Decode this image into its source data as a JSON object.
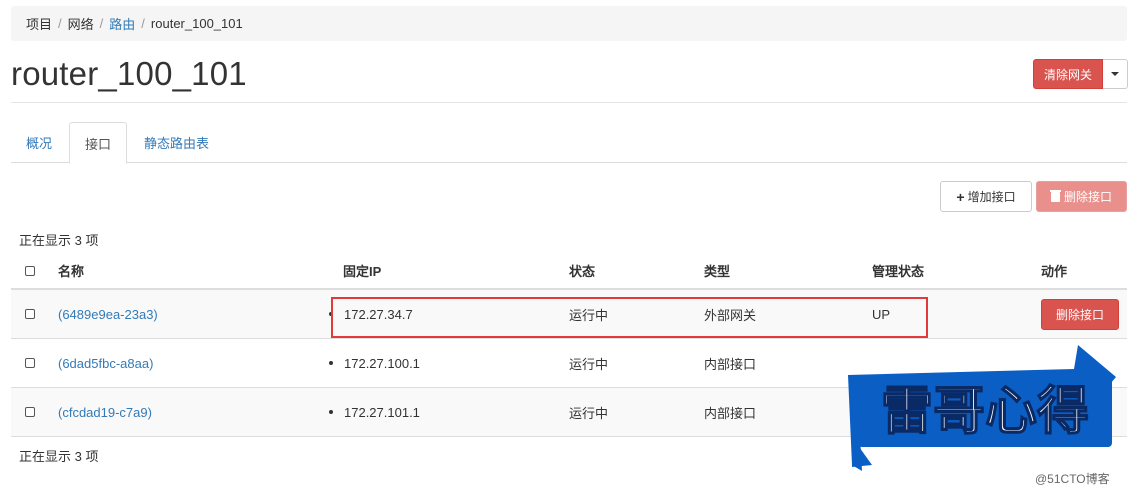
{
  "breadcrumb": {
    "item1": "项目",
    "item2": "网络",
    "item3": "路由",
    "item4": "router_100_101"
  },
  "page": {
    "title": "router_100_101"
  },
  "actions": {
    "clear_gateway": "清除网关"
  },
  "tabs": [
    {
      "label": "概况"
    },
    {
      "label": "接口"
    },
    {
      "label": "静态路由表"
    }
  ],
  "toolbar": {
    "add_interface": "增加接口",
    "delete_interfaces": "删除接口"
  },
  "table": {
    "count": "正在显示 3 项",
    "headers": {
      "name": "名称",
      "ip": "固定IP",
      "status": "状态",
      "type": "类型",
      "admin": "管理状态",
      "action": "动作"
    },
    "rows": [
      {
        "name": "(6489e9ea-23a3)",
        "ip": "172.27.34.7",
        "status": "运行中",
        "type": "外部网关",
        "admin": "UP",
        "action": "删除接口"
      },
      {
        "name": "(6dad5fbc-a8aa)",
        "ip": "172.27.100.1",
        "status": "运行中",
        "type": "内部接口",
        "admin": "",
        "action": ""
      },
      {
        "name": "(cfcdad19-c7a9)",
        "ip": "172.27.101.1",
        "status": "运行中",
        "type": "内部接口",
        "admin": "",
        "action": ""
      }
    ]
  },
  "watermark": {
    "text": "雷哥心得",
    "credit": "@51CTO博客"
  },
  "colors": {
    "danger": "#d9534f",
    "link": "#337ab7",
    "watermark_blue": "#0b5fc4",
    "highlight": "#e03a3a"
  }
}
